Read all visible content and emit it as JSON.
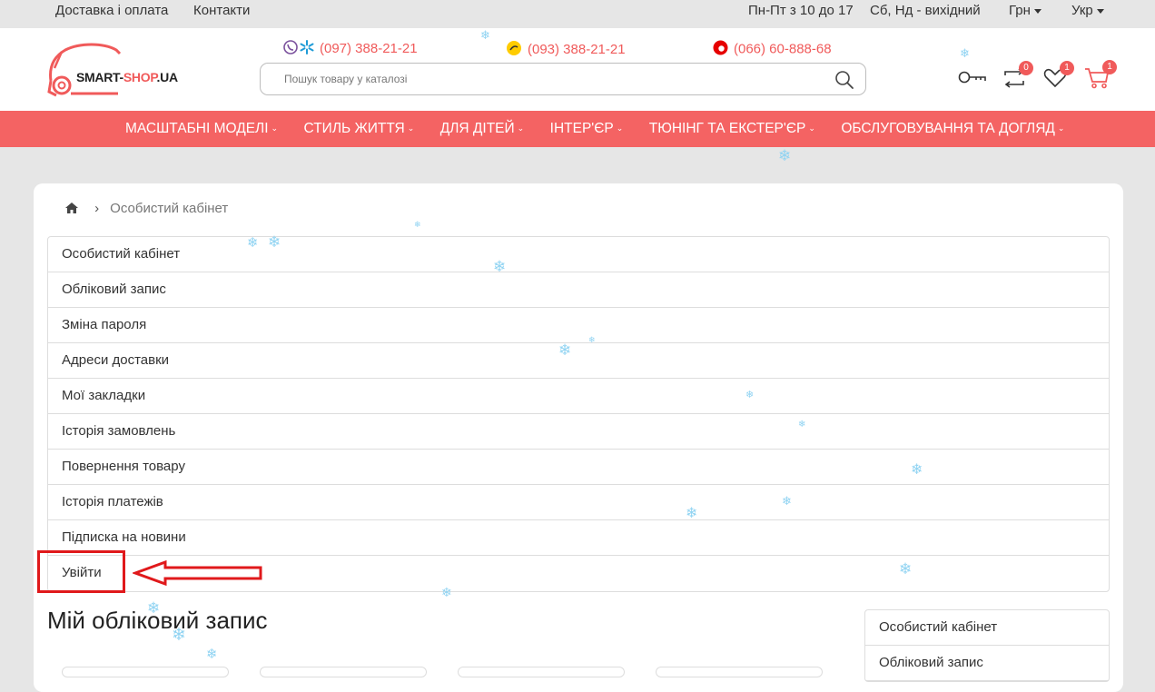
{
  "topbar": {
    "links": [
      "Доставка і оплата",
      "Контакти"
    ],
    "hours_weekday": "Пн-Пт з 10 до 17",
    "hours_weekend": "Сб, Нд - вихідний",
    "currency": "Грн",
    "language": "Укр"
  },
  "logo": {
    "brand_dark": "SMART-",
    "brand_red": "SHOP",
    "brand_tld": ".UA"
  },
  "phones": [
    "(097) 388-21-21",
    "(093) 388-21-21",
    "(066) 60-888-68"
  ],
  "search": {
    "placeholder": "Пошук товару у каталозі",
    "value": ""
  },
  "header_icons": [
    {
      "name": "key-icon"
    },
    {
      "name": "compare-icon",
      "badge": "0"
    },
    {
      "name": "wishlist-heart-icon",
      "badge": "1"
    },
    {
      "name": "cart-icon",
      "badge": "1"
    }
  ],
  "nav": {
    "items": [
      "Масштабні моделі",
      "Стиль життя",
      "Для дітей",
      "Інтер'єр",
      "Тюнінг та екстер'єр",
      "Обслуговування та догляд"
    ]
  },
  "breadcrumb": {
    "current": "Особистий кабінет"
  },
  "account_menu": {
    "items": [
      "Особистий кабінет",
      "Обліковий запис",
      "Зміна пароля",
      "Адреси доставки",
      "Мої закладки",
      "Історія замовлень",
      "Повернення товару",
      "Історія платежів",
      "Підписка на новини",
      "Увійти"
    ]
  },
  "page_title": "Мій обліковий запис",
  "sidebar": {
    "items": [
      "Особистий кабінет",
      "Обліковий запис"
    ]
  },
  "colors": {
    "accent": "#f46363",
    "brand_red": "#f05a5a",
    "annotation_red": "#e0191b",
    "snow": "#8fd3f2"
  }
}
